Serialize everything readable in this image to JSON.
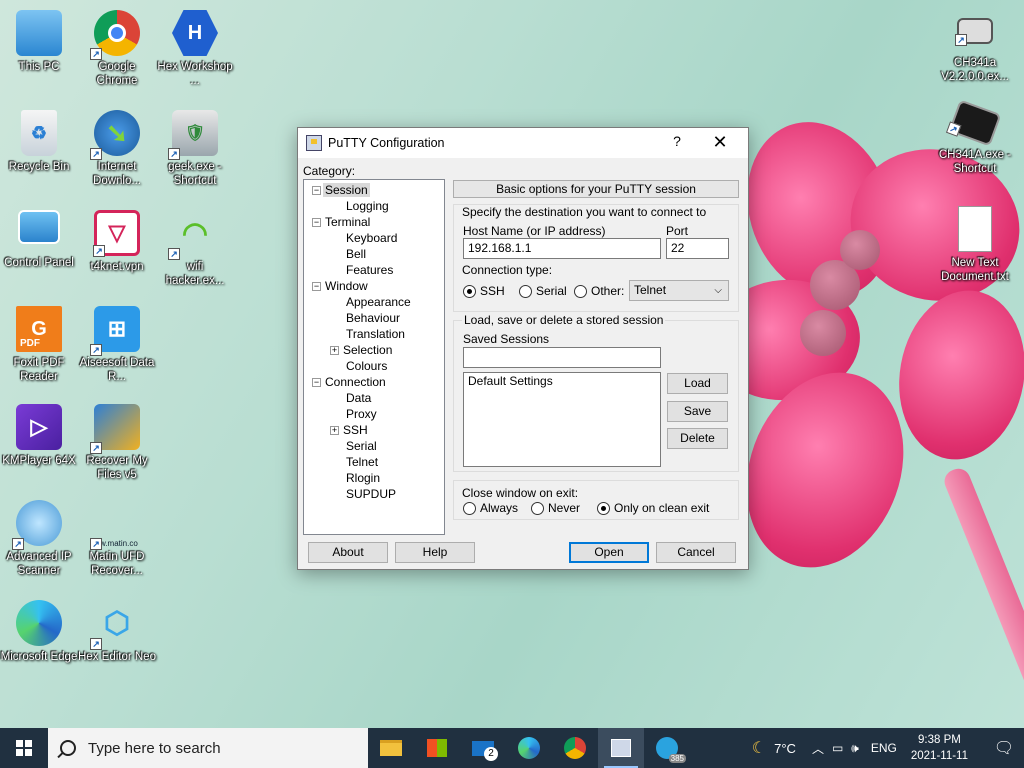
{
  "desktop": {
    "icons_left": [
      {
        "label": "This PC"
      },
      {
        "label": "Google Chrome"
      },
      {
        "label": "Hex Workshop ..."
      },
      {
        "label": "Recycle Bin"
      },
      {
        "label": "Internet Downlo..."
      },
      {
        "label": "geek.exe - Shortcut"
      },
      {
        "label": "Control Panel"
      },
      {
        "label": "t4knet.vpn"
      },
      {
        "label": "wifi hacker.ex..."
      },
      {
        "label": "Foxit PDF Reader"
      },
      {
        "label": "Aiseesoft Data R..."
      },
      {
        "label": "KMPlayer 64X"
      },
      {
        "label": "Recover My Files v5"
      },
      {
        "label": "Advanced IP Scanner"
      },
      {
        "label": "Matin UFD Recover..."
      },
      {
        "label": "Microsoft Edge"
      },
      {
        "label": "Hex Editor Neo"
      }
    ],
    "icons_right": [
      {
        "label": "CH341a V2.2.0.0.ex..."
      },
      {
        "label": "CH341A.exe - Shortcut"
      },
      {
        "label": "New Text Document.txt"
      }
    ],
    "matin_tag": "w.matin.co",
    "hex_letter": "H",
    "pdf_text": "PDF"
  },
  "window": {
    "title": "PuTTY Configuration",
    "help_glyph": "?",
    "close_glyph": "✕",
    "category_label": "Category:",
    "tree": [
      {
        "label": "Session",
        "level": 0,
        "expander": "−"
      },
      {
        "label": "Logging",
        "level": 1
      },
      {
        "label": "Terminal",
        "level": 0,
        "expander": "−"
      },
      {
        "label": "Keyboard",
        "level": 1
      },
      {
        "label": "Bell",
        "level": 1
      },
      {
        "label": "Features",
        "level": 1
      },
      {
        "label": "Window",
        "level": 0,
        "expander": "−"
      },
      {
        "label": "Appearance",
        "level": 1
      },
      {
        "label": "Behaviour",
        "level": 1
      },
      {
        "label": "Translation",
        "level": 1
      },
      {
        "label": "Selection",
        "level": 1,
        "expander": "+"
      },
      {
        "label": "Colours",
        "level": 1
      },
      {
        "label": "Connection",
        "level": 0,
        "expander": "−"
      },
      {
        "label": "Data",
        "level": 1
      },
      {
        "label": "Proxy",
        "level": 1
      },
      {
        "label": "SSH",
        "level": 1,
        "expander": "+"
      },
      {
        "label": "Serial",
        "level": 1
      },
      {
        "label": "Telnet",
        "level": 1
      },
      {
        "label": "Rlogin",
        "level": 1
      },
      {
        "label": "SUPDUP",
        "level": 1
      }
    ],
    "panel_header": "Basic options for your PuTTY session",
    "dest_label": "Specify the destination you want to connect to",
    "host_label": "Host Name (or IP address)",
    "host_value": "192.168.1.1",
    "port_label": "Port",
    "port_value": "22",
    "conn_type_label": "Connection type:",
    "conn_types": {
      "ssh": "SSH",
      "serial": "Serial",
      "other": "Other:"
    },
    "other_select": "Telnet",
    "sessions_group_label": "Load, save or delete a stored session",
    "saved_sessions_label": "Saved Sessions",
    "saved_sessions_value": "",
    "sessions_list": [
      "Default Settings"
    ],
    "load": "Load",
    "save": "Save",
    "delete": "Delete",
    "close_label": "Close window on exit:",
    "close_opts": {
      "always": "Always",
      "never": "Never",
      "clean": "Only on clean exit"
    },
    "about": "About",
    "help": "Help",
    "open": "Open",
    "cancel": "Cancel"
  },
  "taskbar": {
    "search_placeholder": "Type here to search",
    "mail_badge": "2",
    "telegram_badge": "385",
    "weather": "7°C",
    "lang": "ENG",
    "time": "9:38 PM",
    "date": "2021-11-11"
  },
  "colors": {
    "accent": "#0078d7",
    "taskbar": "#203040"
  }
}
